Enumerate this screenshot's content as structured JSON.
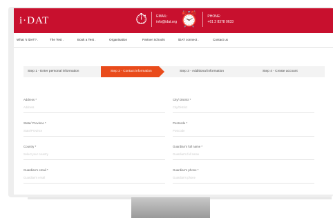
{
  "header": {
    "logo": "i·DAT",
    "email_label": "EMAIL:",
    "email_value": "info@idat.org",
    "phone_label": "PHONE:",
    "phone_value": "+61 2 8378 0633"
  },
  "nav": {
    "items": [
      "What 's iDAT? .",
      "The Test .",
      "Book a Test .",
      "Organisation",
      "Partner Schools",
      "iDAT connect .",
      "Contact us"
    ]
  },
  "steps": [
    {
      "label": "Step 1 - Enter personal information",
      "active": false
    },
    {
      "label": "Step 2 - Contact information",
      "active": true
    },
    {
      "label": "Step 3 - Additional information",
      "active": false
    },
    {
      "label": "Step 4 - Create account",
      "active": false
    }
  ],
  "form": {
    "fields": [
      {
        "label": "Address *",
        "placeholder": "Address"
      },
      {
        "label": "City/ District *",
        "placeholder": "City/District"
      },
      {
        "label": "State/ Province *",
        "placeholder": "State/Province"
      },
      {
        "label": "Postcode *",
        "placeholder": "Postcode"
      },
      {
        "label": "Country *",
        "placeholder": "Select your country"
      },
      {
        "label": "Guardian's full name *",
        "placeholder": "Guardian's full name"
      },
      {
        "label": "Guardian's email *",
        "placeholder": "Guardian's email"
      },
      {
        "label": "Guardian's phone *",
        "placeholder": "Guardian's phone"
      }
    ]
  },
  "colors": {
    "brand": "#c8102e",
    "active_step": "#e94b1b"
  }
}
